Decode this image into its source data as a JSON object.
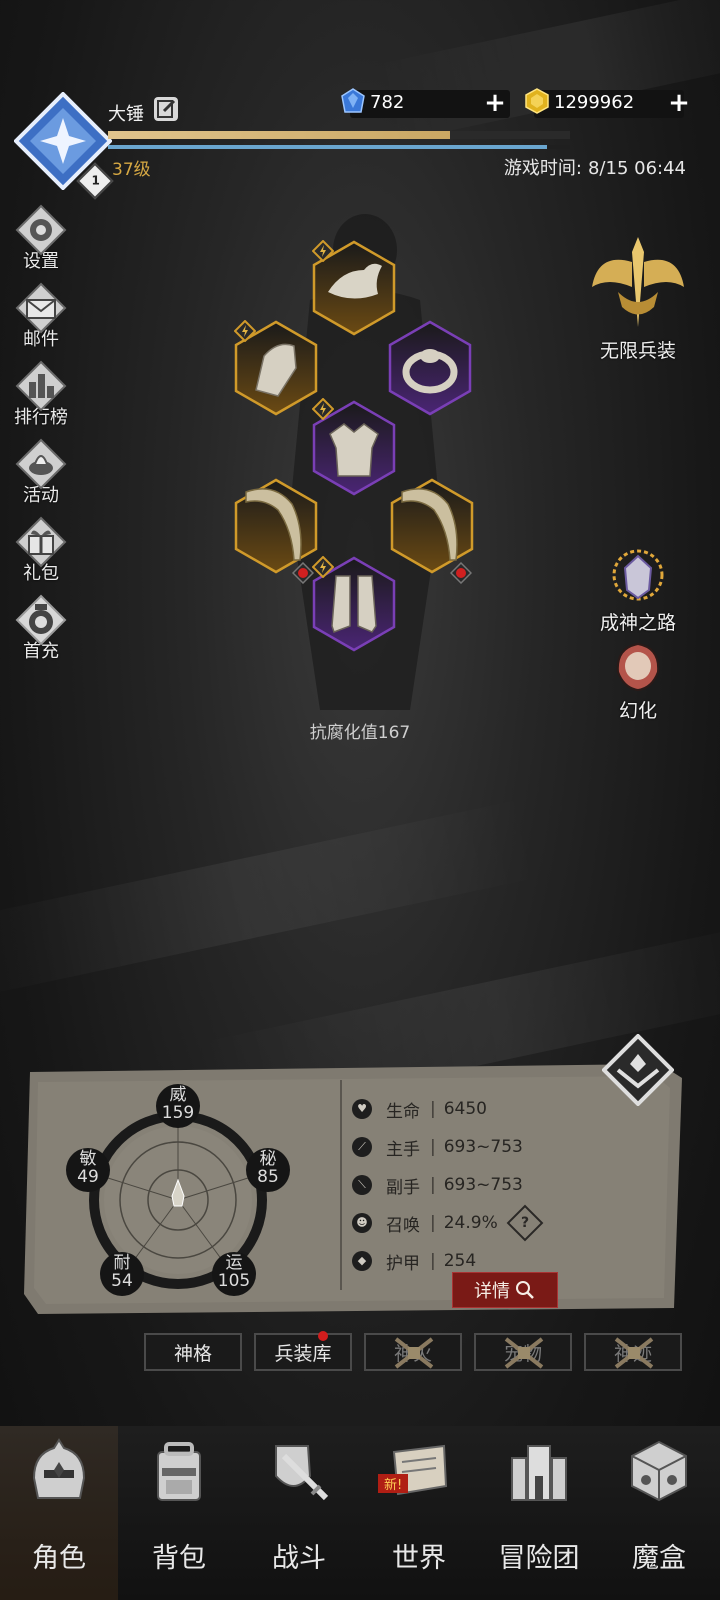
{
  "header": {
    "player_name": "大锤",
    "level_badge": "1",
    "level_text": "37级",
    "xp_fraction": 0.74,
    "gems": "782",
    "gold": "1299962",
    "game_time_label": "游戏时间:",
    "game_time_value": "8/15 06:44"
  },
  "left_menu": [
    {
      "label": "设置",
      "icon": "gear-icon"
    },
    {
      "label": "邮件",
      "icon": "mail-icon"
    },
    {
      "label": "排行榜",
      "icon": "ranking-icon"
    },
    {
      "label": "活动",
      "icon": "event-icon"
    },
    {
      "label": "礼包",
      "icon": "gift-icon"
    },
    {
      "label": "首充",
      "icon": "first-recharge-icon"
    }
  ],
  "right_features": {
    "infinite_gear": "无限兵装",
    "path_to_godhood": "成神之路",
    "transform": "幻化"
  },
  "equipment": {
    "resistance_label": "抗腐化值167"
  },
  "attributes": {
    "wei": {
      "label": "威",
      "value": "159"
    },
    "mi": {
      "label": "秘",
      "value": "85"
    },
    "yun": {
      "label": "运",
      "value": "105"
    },
    "nai": {
      "label": "耐",
      "value": "54"
    },
    "min": {
      "label": "敏",
      "value": "49"
    }
  },
  "stats": [
    {
      "name": "生命",
      "value": "6450",
      "icon": "heart-icon"
    },
    {
      "name": "主手",
      "value": "693~753",
      "icon": "sword-icon"
    },
    {
      "name": "副手",
      "value": "693~753",
      "icon": "offhand-icon"
    },
    {
      "name": "召唤",
      "value": "24.9%",
      "icon": "summon-icon"
    },
    {
      "name": "护甲",
      "value": "254",
      "icon": "armor-icon"
    }
  ],
  "stat_sep": "|",
  "detail_button": "详情",
  "sub_buttons": {
    "divinity": "神格",
    "arsenal": "兵装库",
    "b3": "神火",
    "b4": "宠物",
    "b5": "神迹"
  },
  "nav": {
    "character": "角色",
    "backpack": "背包",
    "battle": "战斗",
    "world": "世界",
    "adventure": "冒险团",
    "magic_box": "魔盒",
    "new_badge": "新!"
  },
  "colors": {
    "accent_gold": "#d6a843",
    "legendary": "#d09a2a",
    "epic": "#7a3fb6",
    "detail_red": "#7a1a16"
  }
}
